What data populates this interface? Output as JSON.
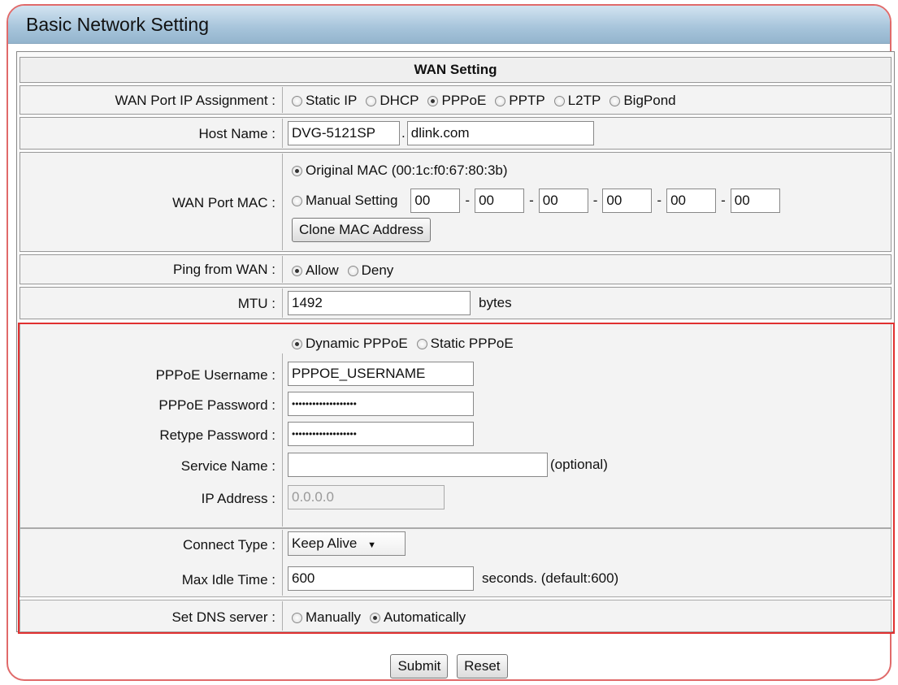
{
  "title": "Basic Network Setting",
  "wan": {
    "heading": "WAN Setting",
    "ip_assignment": {
      "label": "WAN Port IP Assignment :",
      "options": [
        "Static IP",
        "DHCP",
        "PPPoE",
        "PPTP",
        "L2TP",
        "BigPond"
      ],
      "selected": "PPPoE"
    },
    "host_name": {
      "label": "Host Name :",
      "host": "DVG-5121SP",
      "dot": ".",
      "domain": "dlink.com"
    },
    "mac": {
      "label": "WAN Port MAC :",
      "original": "Original MAC (00:1c:f0:67:80:3b)",
      "manual": "Manual Setting",
      "octets": [
        "00",
        "00",
        "00",
        "00",
        "00",
        "00"
      ],
      "sep": "-",
      "clone_button": "Clone MAC Address"
    },
    "ping": {
      "label": "Ping from WAN :",
      "allow": "Allow",
      "deny": "Deny",
      "selected": "Allow"
    },
    "mtu": {
      "label": "MTU :",
      "value": "1492",
      "unit": "bytes"
    }
  },
  "pppoe": {
    "dynamic": "Dynamic PPPoE",
    "static": "Static PPPoE",
    "mode_selected": "Dynamic PPPoE",
    "username": {
      "label": "PPPoE Username :",
      "value": "PPPOE_USERNAME"
    },
    "password": {
      "label": "PPPoE Password :",
      "value": "•••••••••••••••••••"
    },
    "retype": {
      "label": "Retype Password :",
      "value": "•••••••••••••••••••"
    },
    "service": {
      "label": "Service Name :",
      "value": "",
      "hint": "(optional)"
    },
    "ip": {
      "label": "IP Address :",
      "value": "0.0.0.0"
    },
    "connect_type": {
      "label": "Connect Type :",
      "value": "Keep Alive"
    },
    "idle": {
      "label": "Max Idle Time :",
      "value": "600",
      "unit": "seconds. (default:600)"
    },
    "dns": {
      "label": "Set DNS server :",
      "manual": "Manually",
      "auto": "Automatically",
      "selected": "Automatically"
    }
  },
  "buttons": {
    "submit": "Submit",
    "reset": "Reset"
  }
}
